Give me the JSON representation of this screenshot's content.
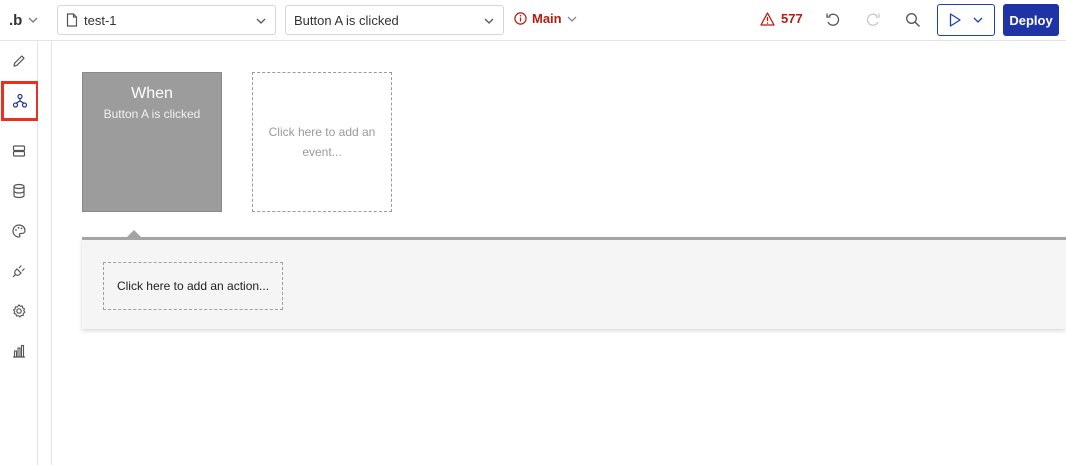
{
  "header": {
    "logo_text": "b",
    "page_select": {
      "value": "test-1"
    },
    "event_select": {
      "value": "Button A is clicked"
    },
    "branch": {
      "label": "Main"
    },
    "issues": {
      "count": "577"
    },
    "preview_label": "",
    "deploy_label": "Deploy"
  },
  "sidebar": {
    "items": [
      {
        "name": "design-icon"
      },
      {
        "name": "workflow-icon",
        "active": true
      },
      {
        "name": "data-icon"
      },
      {
        "name": "database-icon"
      },
      {
        "name": "styles-icon"
      },
      {
        "name": "plugins-icon"
      },
      {
        "name": "settings-icon"
      },
      {
        "name": "logs-icon"
      }
    ]
  },
  "canvas": {
    "event_card": {
      "title": "When",
      "subtitle": "Button A is clicked"
    },
    "add_event_text": "Click here to add an event...",
    "add_action_text": "Click here to add an action..."
  },
  "colors": {
    "accent_blue": "#1e34a6",
    "alert_red": "#b41d0f",
    "highlight_red": "#e8321f",
    "card_gray": "#9c9c9c"
  }
}
